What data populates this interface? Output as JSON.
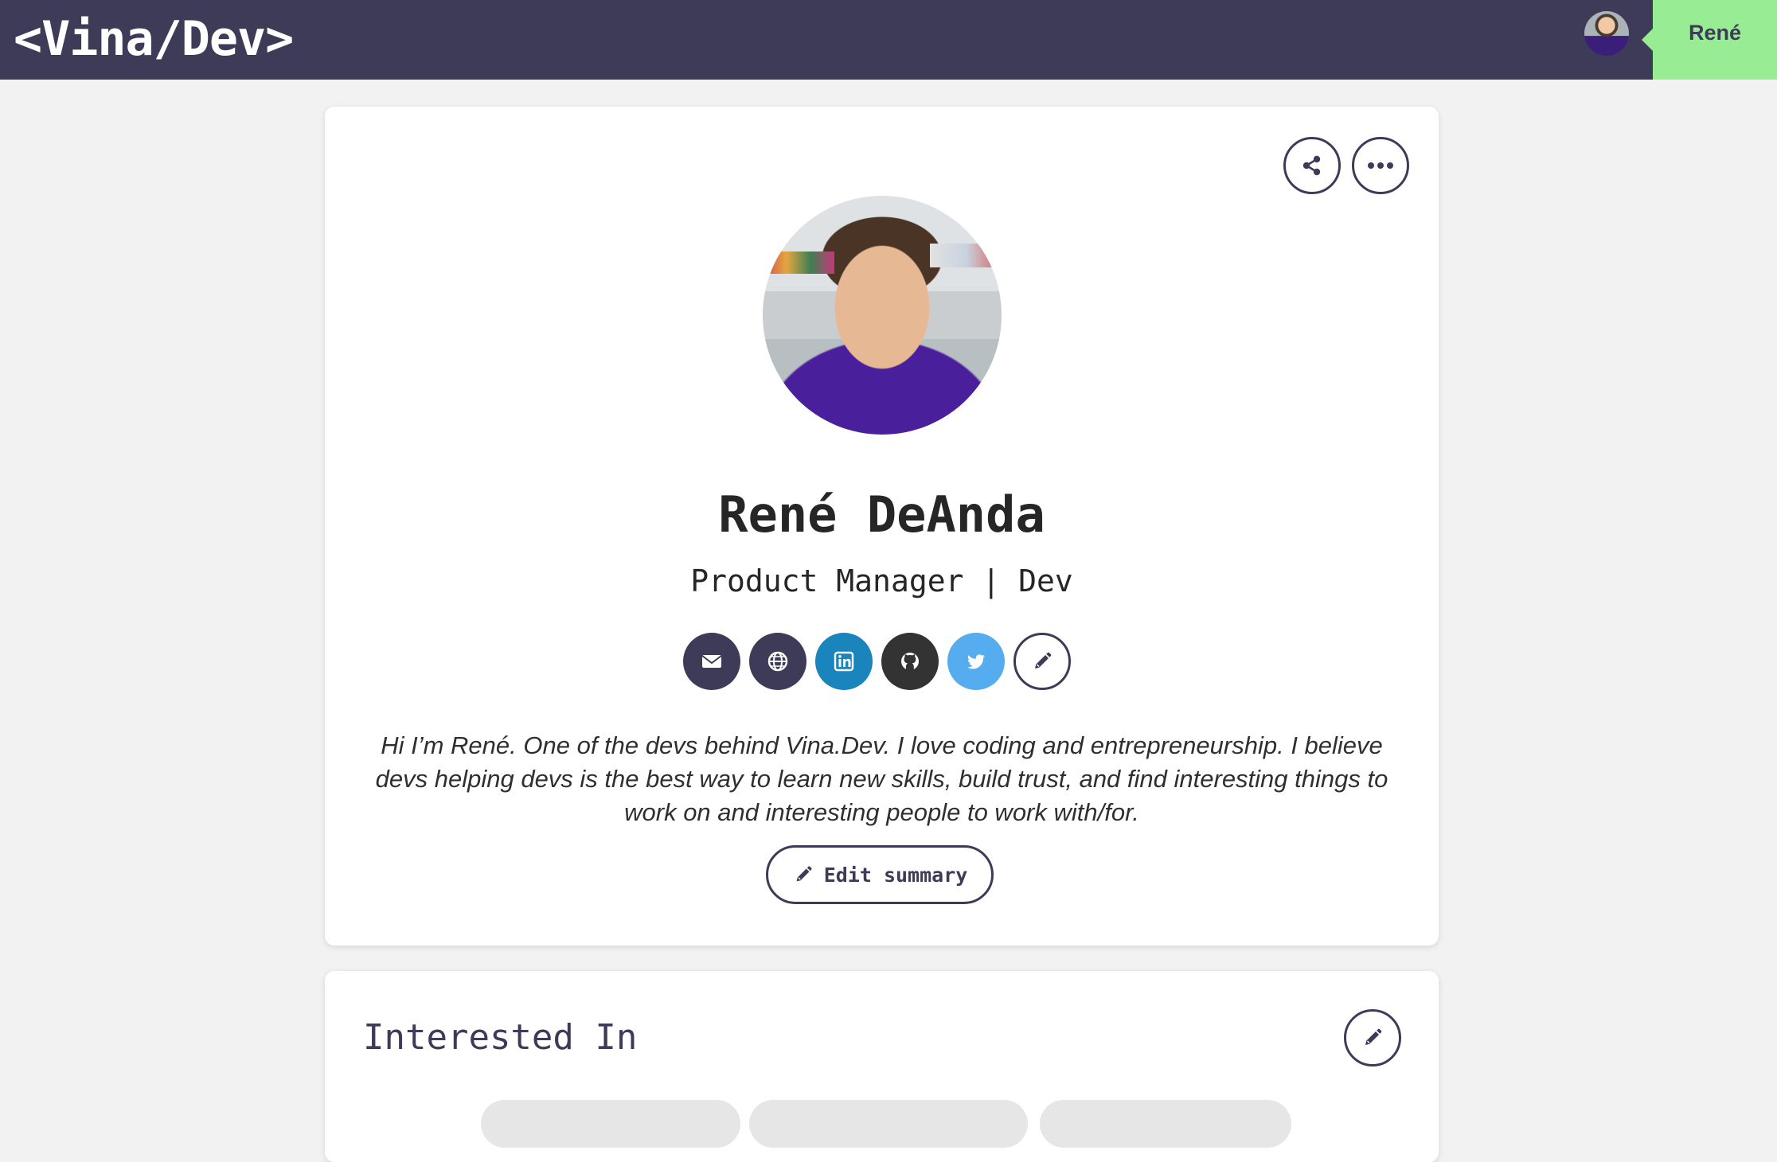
{
  "header": {
    "logo": "<Vina/Dev>",
    "user_name": "René"
  },
  "profile": {
    "name": "René DeAnda",
    "headline": "Product Manager | Dev",
    "summary": "Hi I’m René. One of the devs behind Vina.Dev. I love coding and entrepreneurship. I believe devs helping devs is the best way to learn new skills, build trust, and find interesting things to work on and interesting people to work with/for.",
    "edit_summary_label": "Edit summary",
    "social_links": [
      {
        "icon": "envelope-icon",
        "color": "#3e3b58"
      },
      {
        "icon": "globe-icon",
        "color": "#3e3b58"
      },
      {
        "icon": "linkedin-icon",
        "color": "#1a84bc"
      },
      {
        "icon": "github-icon",
        "color": "#333333"
      },
      {
        "icon": "twitter-icon",
        "color": "#55acee"
      },
      {
        "icon": "pencil-icon",
        "color": "#ffffff"
      }
    ]
  },
  "interests": {
    "title": "Interested In"
  },
  "colors": {
    "nav": "#3e3b58",
    "accent": "#98ec93",
    "background": "#f2f2f2"
  }
}
